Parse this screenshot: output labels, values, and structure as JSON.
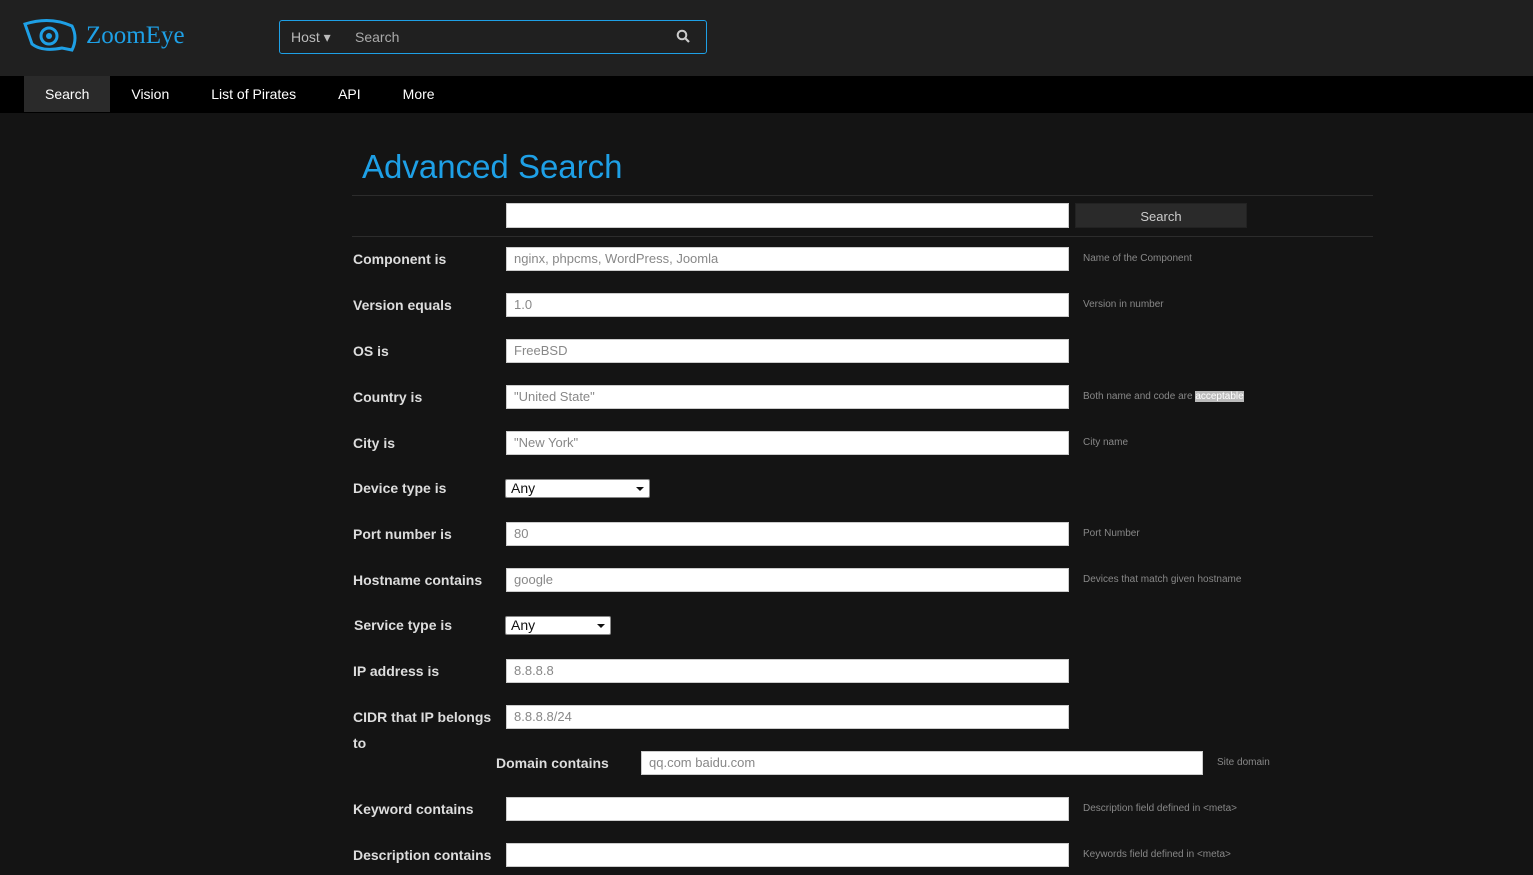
{
  "header": {
    "logo": "ZoomEye",
    "search_type": "Host",
    "search_placeholder": "Search"
  },
  "nav": [
    "Search",
    "Vision",
    "List of Pirates",
    "API",
    "More"
  ],
  "page_title": "Advanced Search",
  "search_button": "Search",
  "fields": [
    {
      "label": "Component is",
      "placeholder": "nginx, phpcms, WordPress, Joomla",
      "hint": "Name of the Component"
    },
    {
      "label": "Version equals",
      "placeholder": "1.0",
      "hint": "Version in number"
    },
    {
      "label": "OS is",
      "placeholder": "FreeBSD",
      "hint": ""
    },
    {
      "label": "Country is",
      "placeholder": "\"United State\"",
      "hint": "Both name and code are ",
      "hint_highlight": "acceptable"
    },
    {
      "label": "City is",
      "placeholder": "\"New York\"",
      "hint": "City name"
    },
    {
      "label": "Device type is",
      "select": "Any"
    },
    {
      "label": "Port number is",
      "placeholder": "80",
      "hint": "Port Number"
    },
    {
      "label": "Hostname contains",
      "placeholder": "google",
      "hint": "Devices that match given hostname"
    },
    {
      "label": "Service type is",
      "select": "Any"
    },
    {
      "label": "IP address is",
      "placeholder": "8.8.8.8",
      "hint": ""
    },
    {
      "label": "CIDR that IP belongs",
      "label2": "to",
      "placeholder": "8.8.8.8/24",
      "hint": ""
    },
    {
      "label": "Domain contains",
      "placeholder": "qq.com baidu.com",
      "hint": "Site domain"
    },
    {
      "label": "Keyword contains",
      "placeholder": "",
      "hint": "Description field defined in <meta>"
    },
    {
      "label": "Description contains",
      "placeholder": "",
      "hint": "Keywords field defined in <meta>"
    }
  ]
}
